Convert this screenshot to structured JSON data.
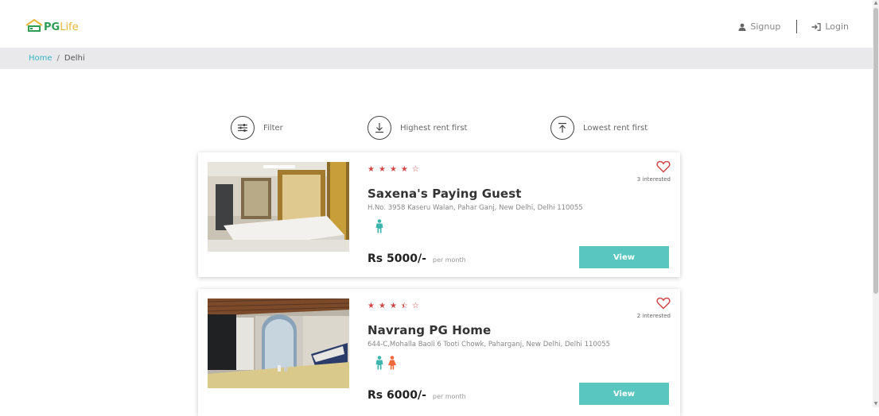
{
  "header": {
    "logo": {
      "pg": "PG",
      "life": "Life"
    },
    "signup_label": "Signup",
    "login_label": "Login"
  },
  "breadcrumb": {
    "home": "Home",
    "separator": "/",
    "current": "Delhi"
  },
  "sort": {
    "filter_label": "Filter",
    "highest_label": "Highest rent first",
    "lowest_label": "Lowest rent first"
  },
  "properties": [
    {
      "rating": 4,
      "name": "Saxena's Paying Guest",
      "address": "H.No. 3958 Kaseru Walan, Pahar Ganj, New Delhi, Delhi 110055",
      "interested": "3 interested",
      "gender": "male",
      "rent": "Rs 5000/-",
      "rent_unit": "per month",
      "view_label": "View"
    },
    {
      "rating": 3.5,
      "name": "Navrang PG Home",
      "address": "644-C,Mohalla Baoli 6 Tooti Chowk, Paharganj, New Delhi, Delhi 110055",
      "interested": "2 interested",
      "gender": "unisex",
      "rent": "Rs 6000/-",
      "rent_unit": "per month",
      "view_label": "View"
    }
  ],
  "colors": {
    "accent": "#5ac6c0",
    "star": "#d04848",
    "link": "#34b6c4",
    "male_icon": "#3fb6ad",
    "female_icon": "#f0693a"
  }
}
